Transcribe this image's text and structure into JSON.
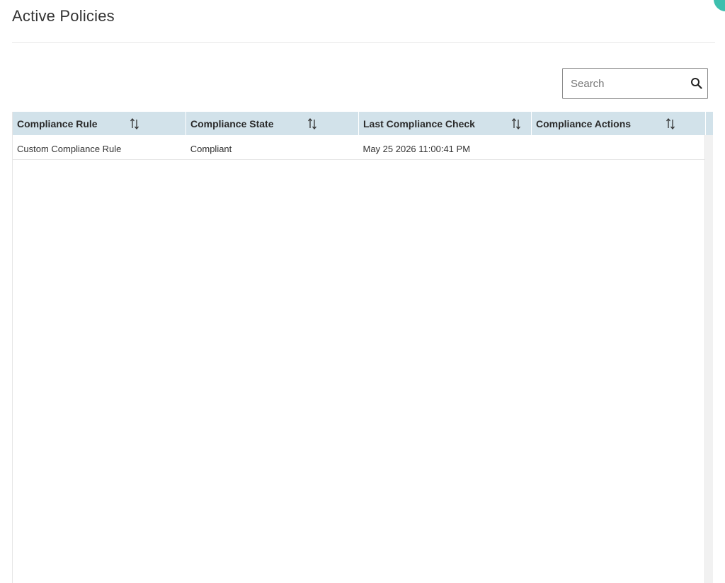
{
  "page": {
    "title": "Active Policies"
  },
  "search": {
    "placeholder": "Search",
    "value": ""
  },
  "table": {
    "columns": [
      {
        "label": "Compliance Rule"
      },
      {
        "label": "Compliance State"
      },
      {
        "label": "Last Compliance Check"
      },
      {
        "label": "Compliance Actions"
      }
    ],
    "rows": [
      {
        "compliance_rule": "Custom Compliance Rule",
        "compliance_state": "Compliant",
        "last_compliance_check": "May 25 2026 11:00:41 PM",
        "compliance_actions": ""
      }
    ]
  },
  "colors": {
    "header_bg": "#d2e2ea",
    "accent": "#3dbfae"
  },
  "icons": {
    "search": "search-icon",
    "sort": "sort-icon"
  }
}
